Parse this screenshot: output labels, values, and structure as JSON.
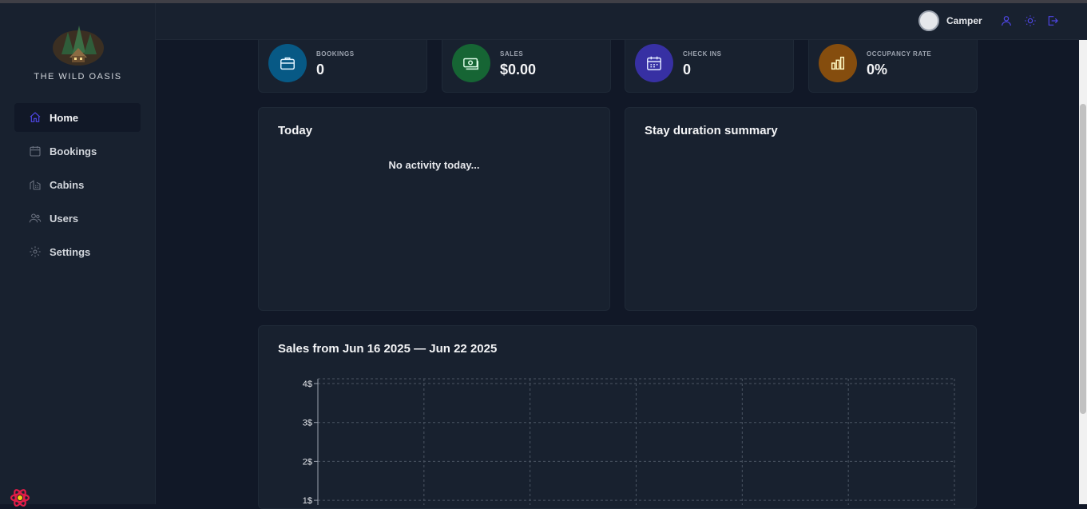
{
  "brand": {
    "name": "THE WILD OASIS"
  },
  "sidebar": {
    "items": [
      {
        "label": "Home",
        "icon": "home-icon",
        "active": true
      },
      {
        "label": "Bookings",
        "icon": "calendar-icon",
        "active": false
      },
      {
        "label": "Cabins",
        "icon": "cabins-icon",
        "active": false
      },
      {
        "label": "Users",
        "icon": "users-icon",
        "active": false
      },
      {
        "label": "Settings",
        "icon": "gear-icon",
        "active": false
      }
    ]
  },
  "header": {
    "user_name": "Camper",
    "icons": [
      "user-icon",
      "sun-icon",
      "logout-icon"
    ]
  },
  "stats": [
    {
      "label": "BOOKINGS",
      "value": "0",
      "color": "#0369a1",
      "icon": "briefcase-icon"
    },
    {
      "label": "SALES",
      "value": "$0.00",
      "color": "#15803d",
      "icon": "banknotes-icon"
    },
    {
      "label": "CHECK INS",
      "value": "0",
      "color": "#4338ca",
      "icon": "calendar-icon"
    },
    {
      "label": "OCCUPANCY RATE",
      "value": "0%",
      "color": "#a16207",
      "icon": "bar-chart-icon"
    }
  ],
  "today": {
    "title": "Today",
    "empty_text": "No activity today..."
  },
  "duration": {
    "title": "Stay duration summary"
  },
  "sales": {
    "title": "Sales from Jun 16 2025 — Jun 22 2025"
  },
  "chart_data": {
    "type": "area",
    "title": "Sales from Jun 16 2025 — Jun 22 2025",
    "y_tick_labels": [
      "4$",
      "3$",
      "2$",
      "1$"
    ],
    "y_ticks": [
      4,
      3,
      2,
      1
    ],
    "ylim": [
      0,
      4
    ],
    "grid": true,
    "series": []
  },
  "colors": {
    "accent": "#4f46e5",
    "bg": "#111827",
    "panel": "#18212f"
  }
}
